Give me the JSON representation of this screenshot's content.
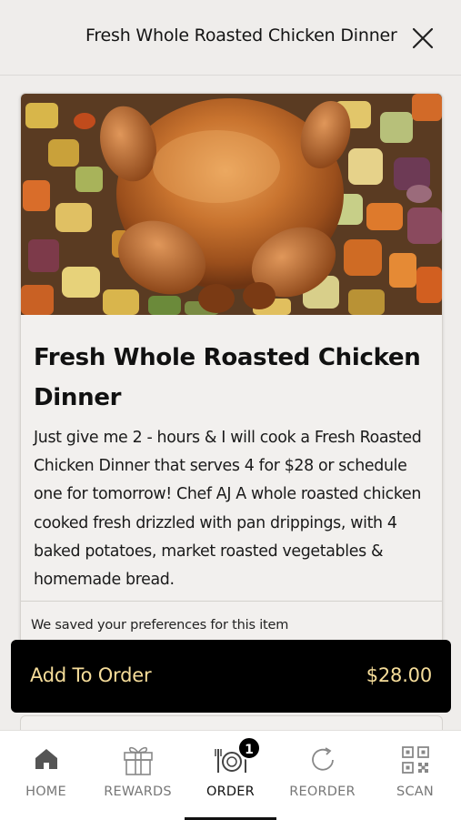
{
  "header": {
    "title": "Fresh Whole Roasted Chicken Dinner"
  },
  "item": {
    "name": "Fresh Whole Roasted Chicken Dinner",
    "description": "Just give me 2 - hours & I will cook a Fresh Roasted Chicken Dinner that serves 4 for $28 or schedule one for tomorrow! Chef AJ A whole roasted chicken cooked fresh drizzled with pan drippings, with 4 baked potatoes, market roasted vegetables & homemade bread.",
    "preferences_note": "We saved your preferences for this item"
  },
  "order_bar": {
    "label": "Add To Order",
    "price": "$28.00",
    "text_color": "#f6dd9a",
    "background": "#000000"
  },
  "tabbar": {
    "tabs": [
      {
        "label": "HOME",
        "icon": "home-icon"
      },
      {
        "label": "REWARDS",
        "icon": "gift-icon"
      },
      {
        "label": "ORDER",
        "icon": "plate-cutlery-icon",
        "active": true,
        "badge": "1"
      },
      {
        "label": "REORDER",
        "icon": "refresh-icon"
      },
      {
        "label": "SCAN",
        "icon": "qr-code-icon"
      }
    ]
  }
}
